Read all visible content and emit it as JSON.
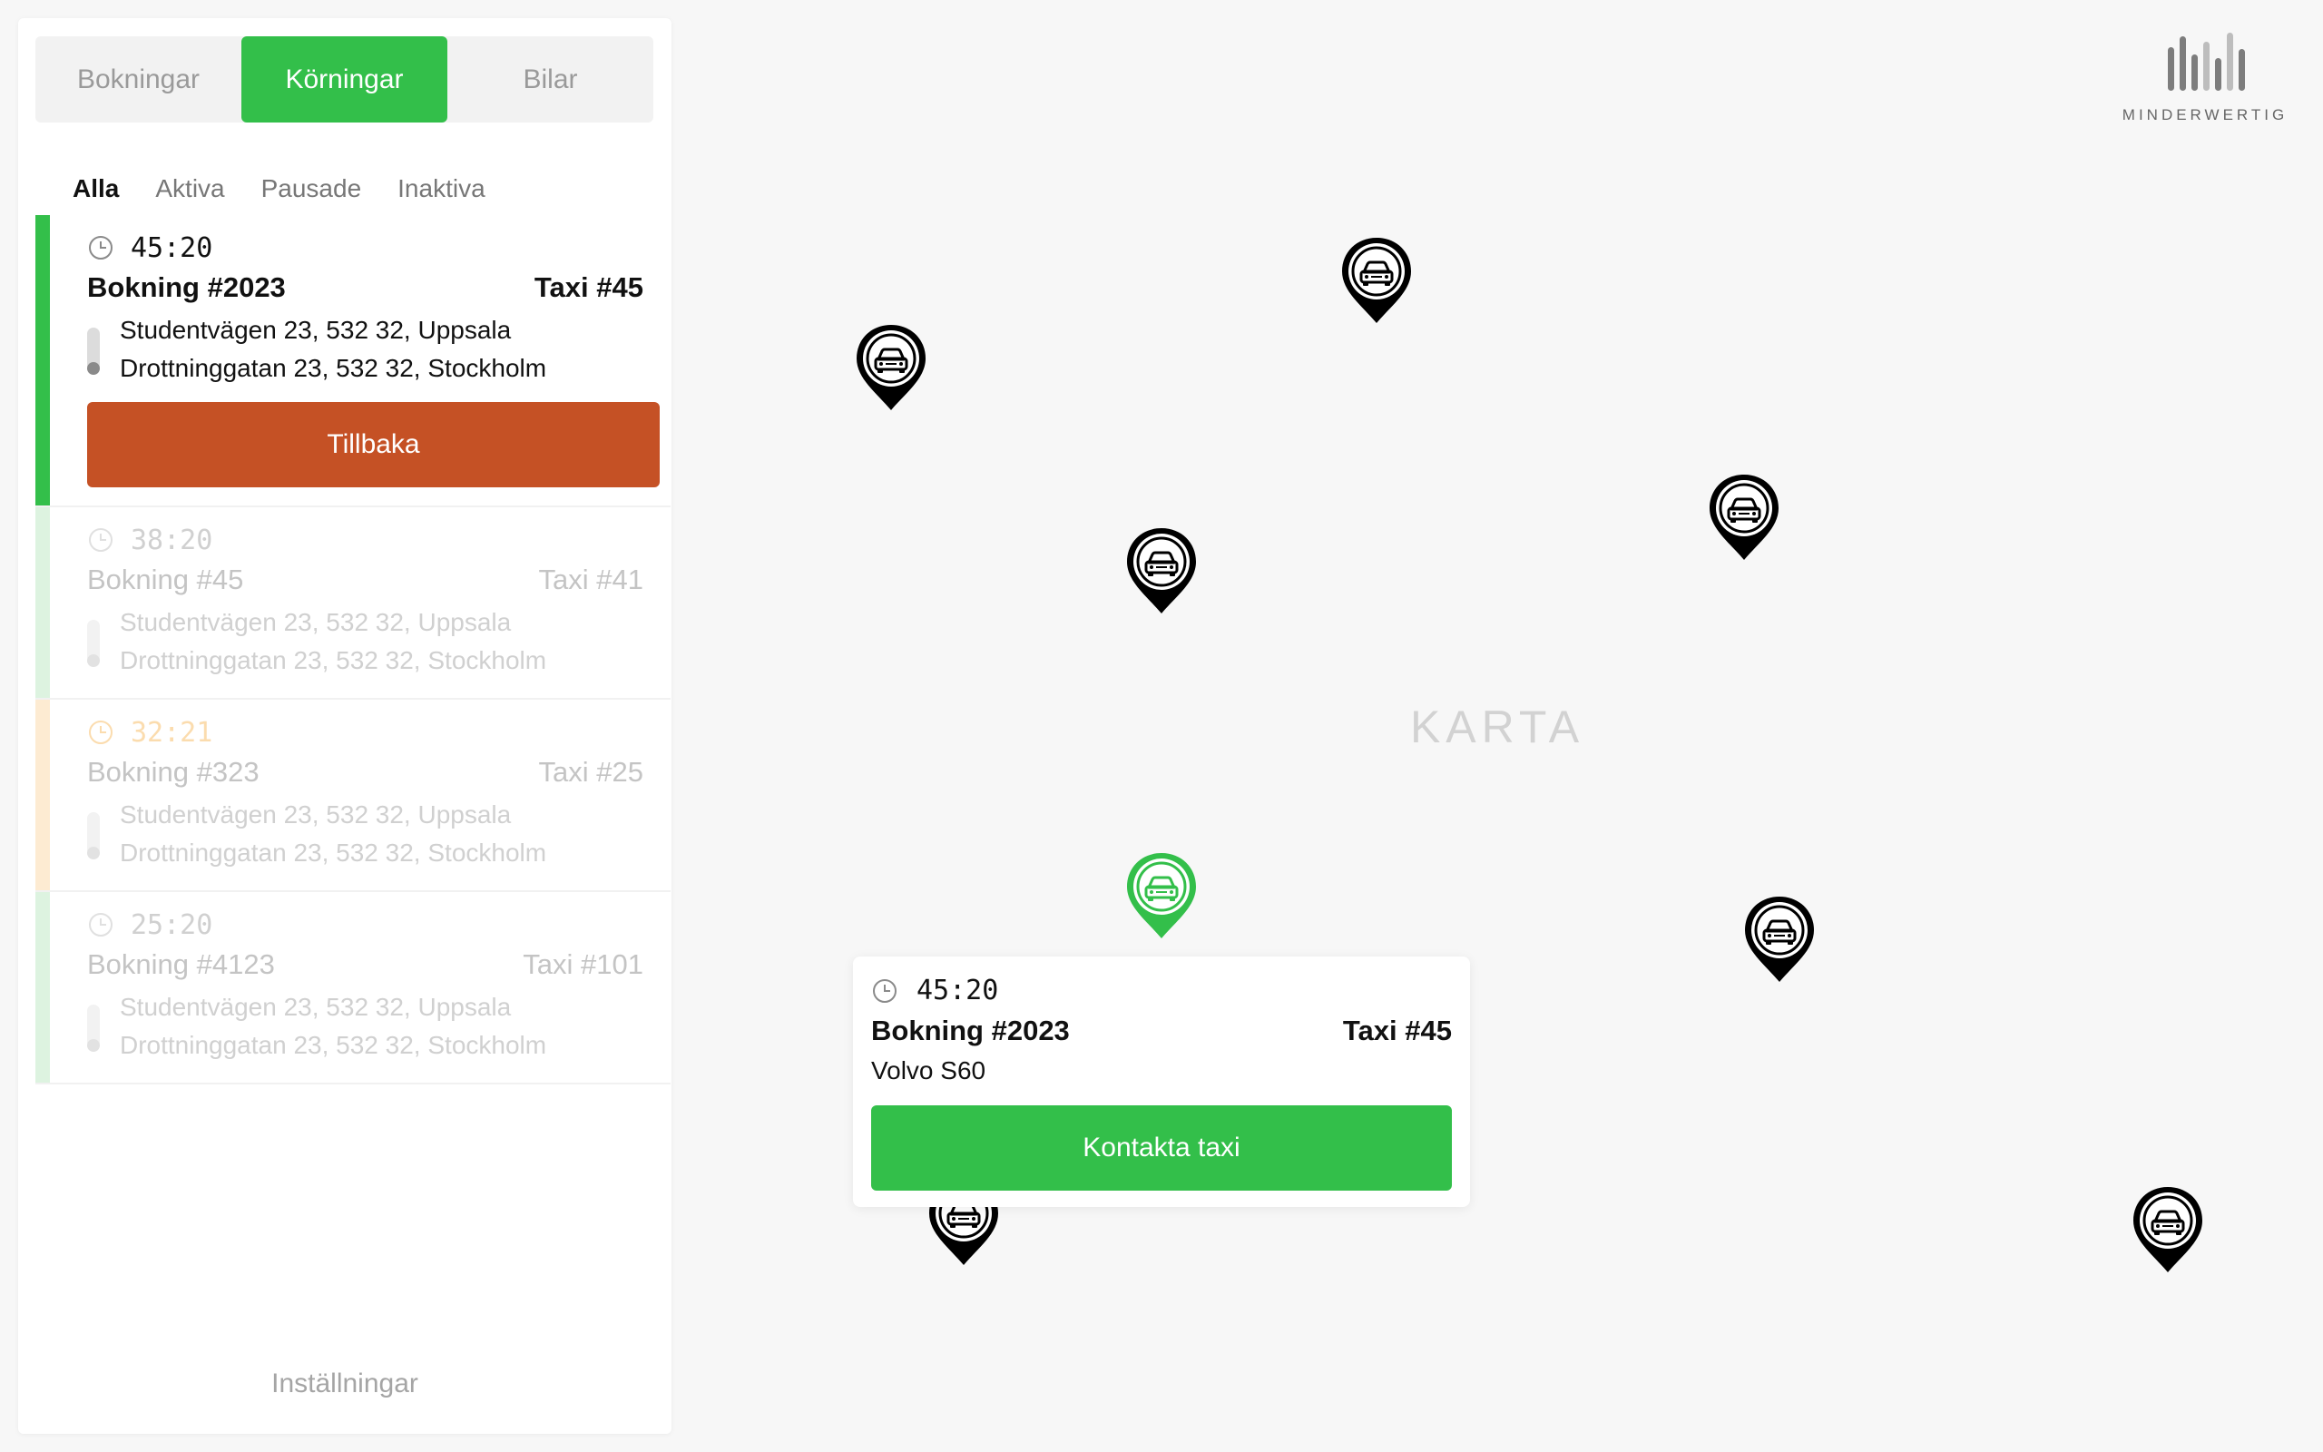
{
  "sidebar": {
    "main_tabs": [
      {
        "label": "Bokningar",
        "active": false
      },
      {
        "label": "Körningar",
        "active": true
      },
      {
        "label": "Bilar",
        "active": false
      }
    ],
    "filter_tabs": [
      {
        "label": "Alla",
        "active": true
      },
      {
        "label": "Aktiva",
        "active": false
      },
      {
        "label": "Pausade",
        "active": false
      },
      {
        "label": "Inaktiva",
        "active": false
      }
    ],
    "rides": [
      {
        "time": "45:20",
        "booking": "Bokning #2023",
        "taxi": "Taxi #45",
        "from": "Studentvägen 23, 532 32, Uppsala",
        "to": "Drottninggatan 23, 532 32, Stockholm",
        "status_color": "#33bf4a",
        "selected": true,
        "button_label": "Tillbaka"
      },
      {
        "time": "38:20",
        "booking": "Bokning #45",
        "taxi": "Taxi #41",
        "from": "Studentvägen 23, 532 32, Uppsala",
        "to": "Drottninggatan 23, 532 32, Stockholm",
        "status_color": "#ddf3e0",
        "clock_color": "#e0e0e0"
      },
      {
        "time": "32:21",
        "booking": "Bokning #323",
        "taxi": "Taxi #25",
        "from": "Studentvägen 23, 532 32, Uppsala",
        "to": "Drottninggatan 23, 532 32, Stockholm",
        "status_color": "#fdebd2",
        "clock_color": "#fbdcae"
      },
      {
        "time": "25:20",
        "booking": "Bokning #4123",
        "taxi": "Taxi #101",
        "from": "Studentvägen 23, 532 32, Uppsala",
        "to": "Drottninggatan 23, 532 32, Stockholm",
        "status_color": "#ddf3e0",
        "clock_color": "#e0e0e0"
      }
    ],
    "settings_label": "Inställningar"
  },
  "map": {
    "label": "KARTA",
    "pins": [
      {
        "id": "pin-1",
        "color": "#000000"
      },
      {
        "id": "pin-2",
        "color": "#000000"
      },
      {
        "id": "pin-3",
        "color": "#000000"
      },
      {
        "id": "pin-4",
        "color": "#000000"
      },
      {
        "id": "pin-5",
        "color": "#33bf4a",
        "selected": true
      },
      {
        "id": "pin-6",
        "color": "#000000"
      },
      {
        "id": "pin-7",
        "color": "#000000"
      },
      {
        "id": "pin-8",
        "color": "#000000"
      }
    ]
  },
  "logo": {
    "text": "MINDERWERTIG"
  },
  "popup": {
    "time": "45:20",
    "booking": "Bokning #2023",
    "taxi": "Taxi #45",
    "car_model": "Volvo S60",
    "button_label": "Kontakta taxi"
  },
  "colors": {
    "accent_green": "#33bf4a",
    "back_button": "#c55125",
    "paused_orange": "#fdebd2"
  }
}
